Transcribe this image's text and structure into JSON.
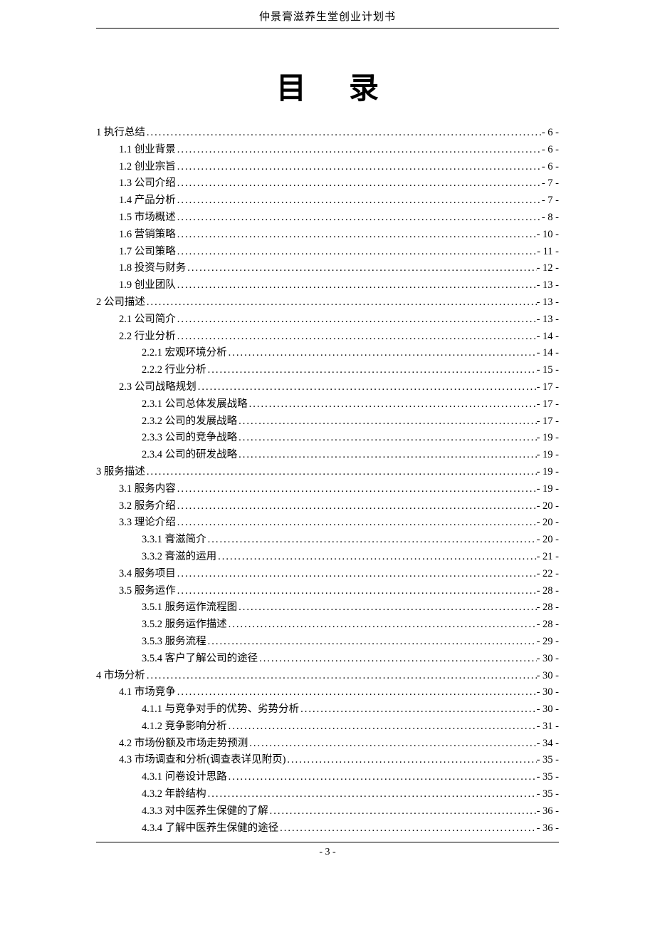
{
  "header": "仲景膏滋养生堂创业计划书",
  "title": "目录",
  "footer": "- 3 -",
  "toc": [
    {
      "level": 1,
      "label": "1 执行总结",
      "page": "- 6 -"
    },
    {
      "level": 2,
      "label": "1.1 创业背景",
      "page": "- 6 -"
    },
    {
      "level": 2,
      "label": "1.2 创业宗旨",
      "page": "- 6 -"
    },
    {
      "level": 2,
      "label": "1.3 公司介绍",
      "page": "- 7 -"
    },
    {
      "level": 2,
      "label": "1.4 产品分析",
      "page": "- 7 -"
    },
    {
      "level": 2,
      "label": "1.5 市场概述",
      "page": "- 8 -"
    },
    {
      "level": 2,
      "label": "1.6 营销策略",
      "page": "- 10 -"
    },
    {
      "level": 2,
      "label": "1.7 公司策略",
      "page": "- 11 -"
    },
    {
      "level": 2,
      "label": "1.8 投资与财务",
      "page": "- 12 -"
    },
    {
      "level": 2,
      "label": "1.9 创业团队",
      "page": "- 13 -"
    },
    {
      "level": 1,
      "label": "2 公司描述",
      "page": "- 13 -"
    },
    {
      "level": 2,
      "label": "2.1 公司简介",
      "page": "- 13 -"
    },
    {
      "level": 2,
      "label": "2.2  行业分析",
      "page": "- 14 -"
    },
    {
      "level": 3,
      "label": "2.2.1  宏观环境分析",
      "page": "- 14 -"
    },
    {
      "level": 3,
      "label": "2.2.2  行业分析",
      "page": "- 15 -"
    },
    {
      "level": 2,
      "label": "2.3  公司战略规划",
      "page": "- 17 -"
    },
    {
      "level": 3,
      "label": "2.3.1 公司总体发展战略",
      "page": "- 17 -"
    },
    {
      "level": 3,
      "label": "2.3.2 公司的发展战略",
      "page": "- 17 -"
    },
    {
      "level": 3,
      "label": "2.3.3 公司的竞争战略",
      "page": "- 19 -"
    },
    {
      "level": 3,
      "label": "2.3.4  公司的研发战略",
      "page": "- 19 -"
    },
    {
      "level": 1,
      "label": "3  服务描述",
      "page": "- 19 -"
    },
    {
      "level": 2,
      "label": "3.1  服务内容",
      "page": "- 19 -"
    },
    {
      "level": 2,
      "label": "3.2  服务介绍",
      "page": "- 20 -"
    },
    {
      "level": 2,
      "label": "3.3  理论介绍",
      "page": "- 20 -"
    },
    {
      "level": 3,
      "label": "3.3.1 膏滋简介",
      "page": "- 20 -"
    },
    {
      "level": 3,
      "label": "3.3.2 膏滋的运用",
      "page": "- 21 -"
    },
    {
      "level": 2,
      "label": "3.4  服务项目",
      "page": "- 22 -"
    },
    {
      "level": 2,
      "label": "3.5  服务运作",
      "page": "- 28 -"
    },
    {
      "level": 3,
      "label": "3.5.1  服务运作流程图",
      "page": "- 28 -"
    },
    {
      "level": 3,
      "label": "3.5.2  服务运作描述",
      "page": "- 28 -"
    },
    {
      "level": 3,
      "label": "3.5.3  服务流程",
      "page": "- 29 -"
    },
    {
      "level": 3,
      "label": "3.5.4    客户了解公司的途径",
      "page": "- 30 -"
    },
    {
      "level": 1,
      "label": "4  市场分析",
      "page": "- 30 -"
    },
    {
      "level": 2,
      "label": "4.1  市场竞争",
      "page": "- 30 -"
    },
    {
      "level": 3,
      "label": "4.1.1  与竞争对手的优势、劣势分析",
      "page": "- 30 -"
    },
    {
      "level": 3,
      "label": "4.1.2  竞争影响分析",
      "page": "- 31 -"
    },
    {
      "level": 2,
      "label": "4.2  市场份额及市场走势预测",
      "page": "- 34 -"
    },
    {
      "level": 2,
      "label": "4.3  市场调查和分析(调查表详见附页)",
      "page": "- 35 -"
    },
    {
      "level": 3,
      "label": "4.3.1  问卷设计思路",
      "page": "- 35 -"
    },
    {
      "level": 3,
      "label": "4.3.2  年龄结构",
      "page": "- 35 -"
    },
    {
      "level": 3,
      "label": "4.3.3  对中医养生保健的了解",
      "page": "- 36 -"
    },
    {
      "level": 3,
      "label": "4.3.4  了解中医养生保健的途径",
      "page": "- 36 -"
    }
  ]
}
